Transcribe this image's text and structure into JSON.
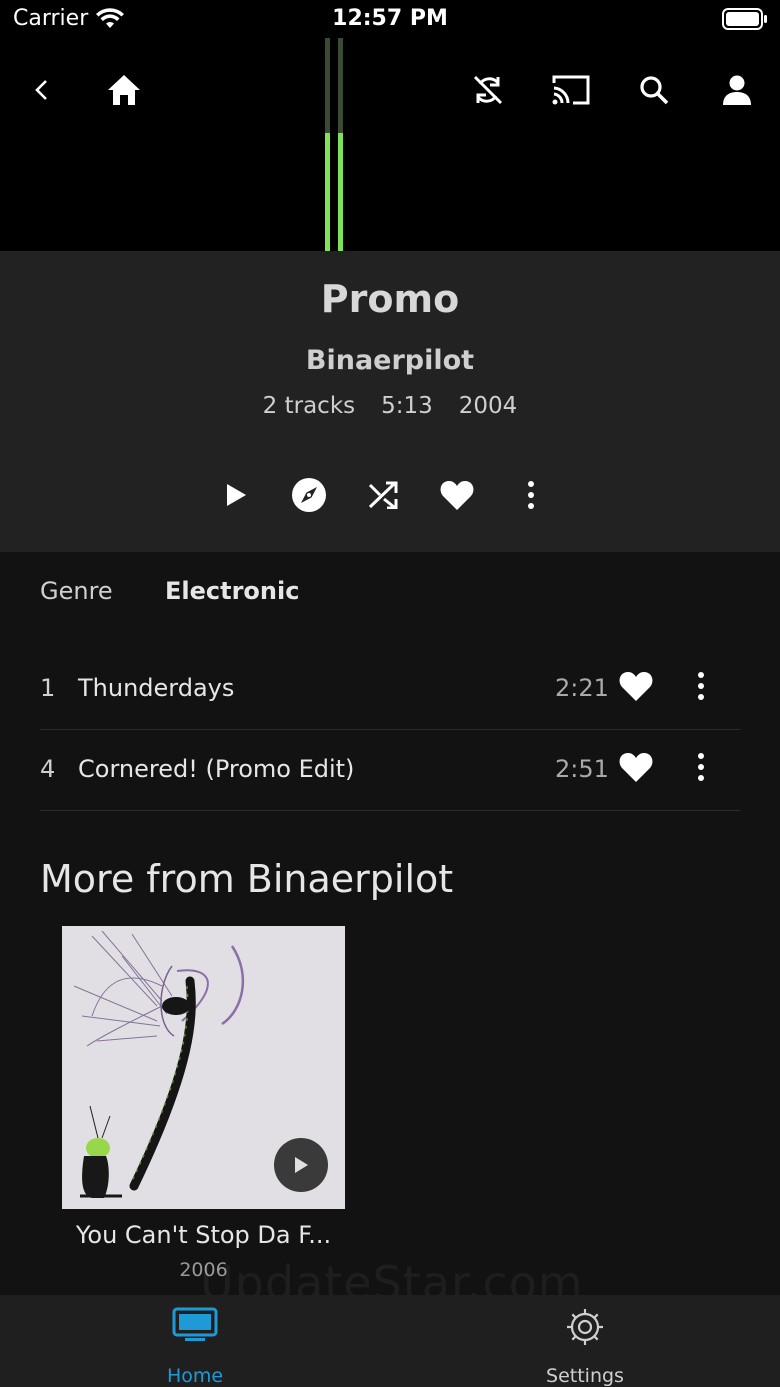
{
  "status_bar": {
    "carrier": "Carrier",
    "time": "12:57 PM"
  },
  "album": {
    "title": "Promo",
    "artist": "Binaerpilot",
    "track_count": "2 tracks",
    "duration": "5:13",
    "year": "2004",
    "genre_label": "Genre",
    "genre_value": "Electronic"
  },
  "tracks": [
    {
      "number": "1",
      "title": "Thunderdays",
      "duration": "2:21"
    },
    {
      "number": "4",
      "title": "Cornered! (Promo Edit)",
      "duration": "2:51"
    }
  ],
  "more_from": {
    "heading": "More from Binaerpilot",
    "albums": [
      {
        "title": "You Can't Stop Da F...",
        "year": "2006"
      }
    ]
  },
  "watermark": "UpdateStar.com",
  "tabs": [
    {
      "label": "Home",
      "icon": "tv-icon",
      "active": true
    },
    {
      "label": "Settings",
      "icon": "gear-icon",
      "active": false
    }
  ],
  "colors": {
    "accent": "#1e9bd7",
    "equalizer": "#7fe35a",
    "header_bg": "#222222",
    "page_bg": "#121212"
  }
}
